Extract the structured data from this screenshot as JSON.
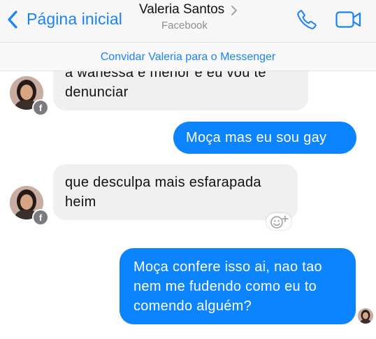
{
  "header": {
    "back_label": "Página inicial",
    "contact_name": "Valeria Santos",
    "contact_subtitle": "Facebook"
  },
  "banner": {
    "text": "Convidar Valeria para o Messenger"
  },
  "badge_letter": "f",
  "messages": [
    {
      "direction": "incoming",
      "line1": "a wanessa e menor e eu vou te",
      "line2": "denunciar"
    },
    {
      "direction": "outgoing",
      "line1": "Moça mas eu sou gay"
    },
    {
      "direction": "incoming",
      "line1": "que desculpa mais esfarapada",
      "line2": "heim"
    },
    {
      "direction": "outgoing",
      "line1": "Moça confere isso ai, nao tao",
      "line2": "nem me fudendo como eu to",
      "line3": "comendo alguém?"
    }
  ],
  "icons": {
    "back": "chevron-left-icon",
    "name_arrow": "chevron-right-icon",
    "phone": "phone-icon",
    "video": "video-camera-icon",
    "reaction": "add-reaction-icon"
  },
  "colors": {
    "accent": "#1a82f7",
    "outgoing_bubble": "#0b84fe",
    "incoming_bubble": "#f0f0f0"
  }
}
